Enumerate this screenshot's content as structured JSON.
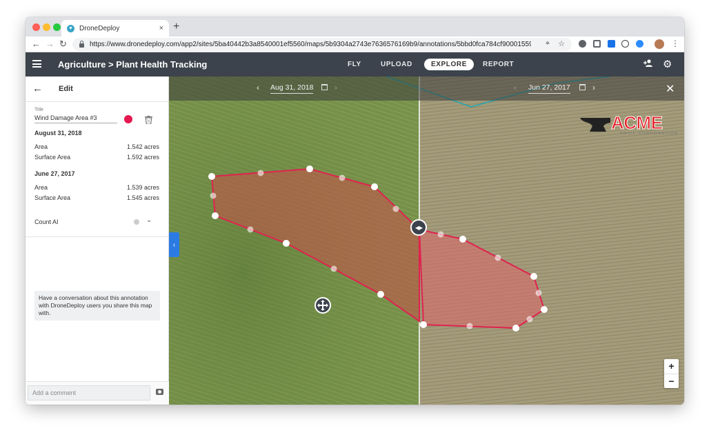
{
  "browser": {
    "tab_title": "DroneDeploy",
    "tab_close": "×",
    "new_tab": "+",
    "url": "https://www.dronedeploy.com/app2/sites/5ba40442b3a8540001ef5560/maps/5b9304a2743e7636576169b9/annotations/5bbd0fca784cf90001559..."
  },
  "appbar": {
    "title": "Agriculture > Plant Health Tracking",
    "nav": [
      "FLY",
      "UPLOAD",
      "EXPLORE",
      "REPORT"
    ],
    "active_nav": "EXPLORE",
    "icons": [
      "menu-icon",
      "add-user-icon",
      "gear-icon"
    ]
  },
  "sidebar": {
    "header": "Edit",
    "title_caption": "Title",
    "title_value": "Wind Damage Area #3",
    "annotation_color": "#e5174f",
    "sections": [
      {
        "date": "August 31, 2018",
        "rows": [
          {
            "label": "Area",
            "value": "1.542 acres"
          },
          {
            "label": "Surface Area",
            "value": "1.592 acres"
          }
        ]
      },
      {
        "date": "June 27, 2017",
        "rows": [
          {
            "label": "Area",
            "value": "1.539 acres"
          },
          {
            "label": "Surface Area",
            "value": "1.545 acres"
          }
        ]
      }
    ],
    "count_ai_label": "Count AI",
    "conversation_text": "Have a conversation about this annotation with DroneDeploy users you share this map with.",
    "comment_placeholder": "Add a comment"
  },
  "map": {
    "left_date": "Aug 31, 2018",
    "right_date": "Jun 27, 2017",
    "logo_word": "ACME",
    "logo_sub": "ANVIL CORPORATION",
    "zoom_in": "+",
    "zoom_out": "−",
    "colors": {
      "polygon_stroke": "#e0224f",
      "polygon_fill": "#d4504f",
      "field_left": "#6f8a44",
      "field_right": "#a39b7a",
      "boundary": "#1aa6b2"
    }
  }
}
